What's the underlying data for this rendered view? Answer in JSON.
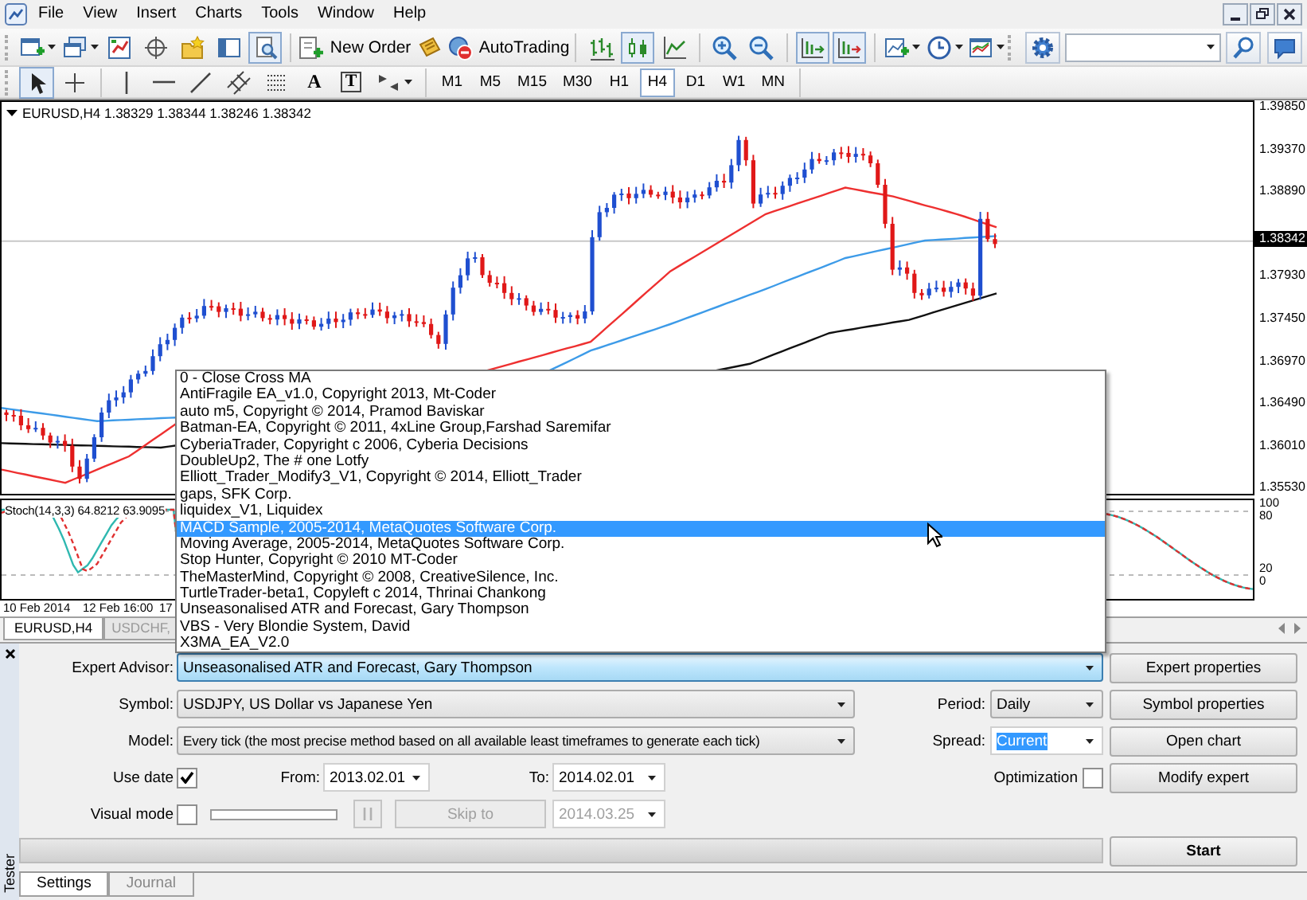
{
  "menu_bar": {
    "items": [
      "File",
      "View",
      "Insert",
      "Charts",
      "Tools",
      "Window",
      "Help"
    ]
  },
  "toolbar_standard": {
    "groups": [
      [
        {
          "kind": "icon",
          "pressed": false
        },
        {
          "kind": "icon",
          "pressed": false
        },
        {
          "kind": "icon",
          "pressed": false
        },
        {
          "kind": "icon",
          "pressed": false
        },
        {
          "kind": "icon",
          "pressed": false
        },
        {
          "kind": "icon",
          "pressed": false
        },
        {
          "kind": "icon",
          "pressed": true
        }
      ],
      [
        {
          "kind": "text",
          "label": "New Order"
        },
        {
          "kind": "icon",
          "pressed": false
        },
        {
          "kind": "text",
          "label": "AutoTrading"
        }
      ],
      [
        {
          "kind": "icon",
          "pressed": false
        },
        {
          "kind": "icon",
          "pressed": true
        },
        {
          "kind": "icon",
          "pressed": false
        }
      ],
      [
        {
          "kind": "icon",
          "pressed": false
        },
        {
          "kind": "icon",
          "pressed": false
        }
      ],
      [
        {
          "kind": "icon",
          "pressed": true
        },
        {
          "kind": "icon",
          "pressed": true
        }
      ],
      [
        {
          "kind": "icon",
          "pressed": false
        },
        {
          "kind": "icon",
          "pressed": false
        },
        {
          "kind": "icon",
          "pressed": false
        }
      ]
    ]
  },
  "toolbar_tools": {
    "groups": [
      [
        {
          "kind": "icon",
          "pressed": true
        },
        {
          "kind": "icon",
          "pressed": false
        }
      ],
      [
        {
          "kind": "icon",
          "pressed": false
        },
        {
          "kind": "icon",
          "pressed": false
        },
        {
          "kind": "icon",
          "pressed": false
        },
        {
          "kind": "icon",
          "pressed": false
        },
        {
          "kind": "icon",
          "pressed": false
        },
        {
          "kind": "glyph",
          "label": "A",
          "pressed": false
        },
        {
          "kind": "boxed_glyph",
          "label": "T",
          "pressed": false
        },
        {
          "kind": "icon",
          "pressed": false
        }
      ]
    ],
    "timeframes": [
      {
        "label": "M1",
        "selected": false
      },
      {
        "label": "M5",
        "selected": false
      },
      {
        "label": "M15",
        "selected": false
      },
      {
        "label": "M30",
        "selected": false
      },
      {
        "label": "H1",
        "selected": false
      },
      {
        "label": "H4",
        "selected": true
      },
      {
        "label": "D1",
        "selected": false
      },
      {
        "label": "W1",
        "selected": false
      },
      {
        "label": "MN",
        "selected": false
      }
    ]
  },
  "chart": {
    "header": "EURUSD,H4 1.38329 1.38344 1.38246 1.38342",
    "price_labels": [
      "1.39850",
      "1.39370",
      "1.38890",
      "1.37930",
      "1.37450",
      "1.36970",
      "1.36490",
      "1.36010",
      "1.35530"
    ],
    "current_price": "1.38342",
    "indicator": {
      "header": "Stoch(14,3,3) 64.8212 63.9095",
      "scale_labels": [
        "100",
        "80",
        "20",
        "0"
      ]
    },
    "time_labels": [
      "10 Feb 2014",
      "12 Feb 16:00",
      "17"
    ]
  },
  "chart_tabs": [
    {
      "label": "EURUSD,H4",
      "selected": true
    },
    {
      "label": "USDCHF,",
      "selected": false
    }
  ],
  "expert_list": {
    "items": [
      {
        "label": "0 - Close Cross MA",
        "selected": false
      },
      {
        "label": "AntiFragile EA_v1.0, Copyright 2013, Mt-Coder",
        "selected": false
      },
      {
        "label": "auto m5, Copyright © 2014, Pramod Baviskar",
        "selected": false
      },
      {
        "label": "Batman-EA, Copyright © 2011, 4xLine Group,Farshad Saremifar",
        "selected": false
      },
      {
        "label": "CyberiaTrader, Copyright c 2006, Cyberia Decisions",
        "selected": false
      },
      {
        "label": "DoubleUp2, The # one Lotfy",
        "selected": false
      },
      {
        "label": "Elliott_Trader_Modify3_V1, Copyright © 2014, Elliott_Trader",
        "selected": false
      },
      {
        "label": "gaps, SFK Corp.",
        "selected": false
      },
      {
        "label": "liquidex_V1, Liquidex",
        "selected": false
      },
      {
        "label": "MACD Sample, 2005-2014, MetaQuotes Software Corp.",
        "selected": true
      },
      {
        "label": "Moving Average, 2005-2014, MetaQuotes Software Corp.",
        "selected": false
      },
      {
        "label": "Stop Hunter, Copyright © 2010 MT-Coder",
        "selected": false
      },
      {
        "label": "TheMasterMind, Copyright © 2008, CreativeSilence, Inc.",
        "selected": false
      },
      {
        "label": "TurtleTrader-beta1, Copyleft c 2014, Thrinai Chankong",
        "selected": false
      },
      {
        "label": "Unseasonalised ATR and Forecast, Gary Thompson",
        "selected": false
      },
      {
        "label": "VBS - Very Blondie System, David",
        "selected": false
      },
      {
        "label": "X3MA_EA_V2.0",
        "selected": false
      }
    ]
  },
  "tester": {
    "title": "Tester",
    "expert_advisor": {
      "label": "Expert Advisor:",
      "value": "Unseasonalised ATR and Forecast, Gary Thompson",
      "focused": true
    },
    "symbol": {
      "label": "Symbol:",
      "value": "USDJPY, US Dollar vs Japanese Yen"
    },
    "period": {
      "label": "Period:",
      "value": "Daily"
    },
    "model": {
      "label": "Model:",
      "value": "Every tick (the most precise method based on all available least timeframes to generate each tick)"
    },
    "spread": {
      "label": "Spread:",
      "value": "Current",
      "text_selected": true
    },
    "use_date": {
      "label": "Use date",
      "checked": true
    },
    "from": {
      "label": "From:",
      "value": "2013.02.01"
    },
    "to": {
      "label": "To:",
      "value": "2014.02.01"
    },
    "optimization": {
      "label": "Optimization",
      "checked": false
    },
    "visual_mode": {
      "label": "Visual mode",
      "checked": false
    },
    "speed_slider": {
      "level": 0
    },
    "pause_button": {
      "disabled": true
    },
    "skip_button": {
      "label": "Skip to",
      "disabled": true
    },
    "skip_date": {
      "value": "2014.03.25",
      "disabled": true
    },
    "progress": {
      "level": 0
    },
    "buttons": [
      {
        "label": "Expert properties",
        "kind": "normal"
      },
      {
        "label": "Symbol properties",
        "kind": "normal"
      },
      {
        "label": "Open chart",
        "kind": "normal"
      },
      {
        "label": "Modify expert",
        "kind": "normal"
      },
      {
        "label": "Start",
        "kind": "primary"
      }
    ],
    "tabs": [
      {
        "label": "Settings",
        "selected": true
      },
      {
        "label": "Journal",
        "selected": false
      }
    ]
  }
}
